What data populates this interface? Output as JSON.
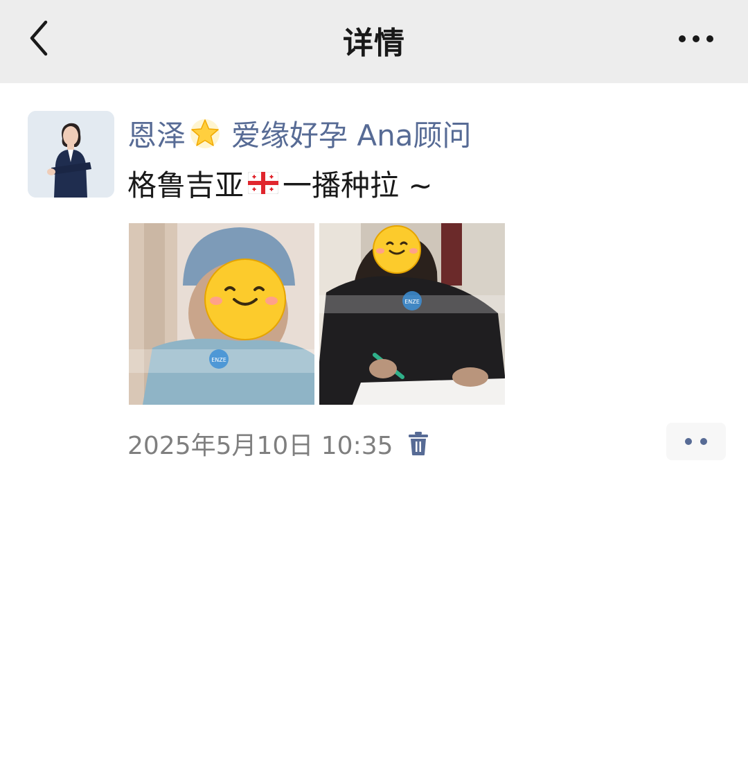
{
  "header": {
    "title": "详情",
    "back_icon": "chevron-left-icon",
    "more_icon": "more-horizontal-icon"
  },
  "post": {
    "author_part1": "恩泽",
    "author_emoji": "glowing-star-icon",
    "author_part2": "爱缘好孕 Ana顾问",
    "text_before_flag": "格鲁吉亚",
    "flag": "georgia-flag-icon",
    "text_after_flag": "一播种拉 ~",
    "images": [
      {
        "icon": "photo-patient-icon",
        "watermark": "ENZE"
      },
      {
        "icon": "photo-signing-icon",
        "watermark": "ENZE"
      }
    ],
    "timestamp": "2025年5月10日 10:35",
    "delete_icon": "trash-icon",
    "comment_icon": "comment-dots-icon"
  },
  "colors": {
    "header_bg": "#ededed",
    "link": "#576b95",
    "text": "#191919",
    "meta": "#7f7f7f"
  }
}
